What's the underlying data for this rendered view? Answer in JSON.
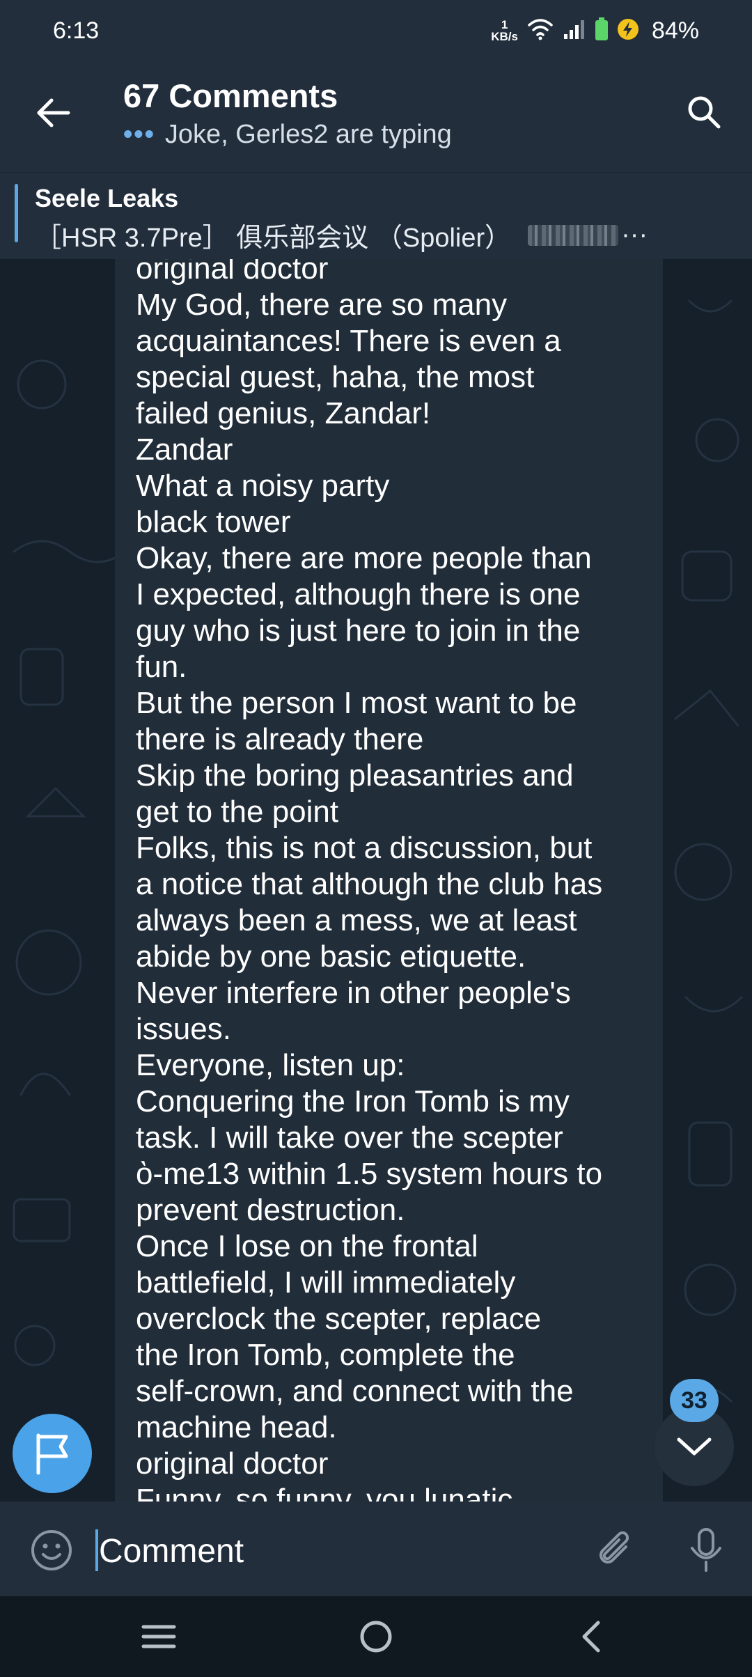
{
  "status_bar": {
    "time": "6:13",
    "net_speed_value": "1",
    "net_speed_unit": "KB/s",
    "battery": "84%"
  },
  "header": {
    "title": "67 Comments",
    "typing_dots": "•••",
    "typing": "Joke, Gerles2 are typing"
  },
  "pinned": {
    "title": "Seele Leaks",
    "text": "［HSR 3.7Pre］ 俱乐部会议 （Spolier）",
    "more": "···"
  },
  "message": {
    "lines": [
      "original doctor",
      "My God, there are so many",
      "acquaintances! There is even a",
      "special guest, haha, the most",
      "failed genius, Zandar!",
      "Zandar",
      "What a noisy party",
      "black tower",
      "Okay, there are more people than",
      "I expected, although there is one",
      "guy who is just here to join in the",
      "fun.",
      "But the person I most want to be",
      "there is already there",
      "Skip the boring pleasantries and",
      "get to the point",
      "Folks, this is not a discussion, but",
      "a notice that although the club has",
      "always been a mess, we at least",
      "abide by one basic etiquette.",
      "Never interfere in other people's",
      "issues.",
      "Everyone, listen up:",
      "Conquering the Iron Tomb is my",
      "task. I will take over the scepter",
      "ὸ-me13 within 1.5 system hours to",
      "prevent destruction.",
      "Once I lose on the frontal",
      "battlefield, I will immediately",
      "overclock the scepter, replace",
      "the Iron Tomb, complete the",
      "self-crown, and connect with the",
      "machine head.",
      "original doctor",
      "Funny, so funny, you lunatic"
    ]
  },
  "unread_count": "33",
  "composer": {
    "placeholder": "Comment"
  },
  "colors": {
    "accent": "#5aa8e6",
    "header_bg": "#222e3b",
    "bubble_bg": "#212d39",
    "chat_bg": "#16202b",
    "flag_button": "#4aa2e8"
  },
  "icons": [
    "back-arrow-icon",
    "search-icon",
    "flag-icon",
    "chevron-down-icon",
    "emoji-icon",
    "attach-icon",
    "microphone-icon",
    "wifi-icon",
    "signal-icon",
    "battery-icon",
    "recents-icon",
    "home-icon",
    "nav-back-icon"
  ]
}
